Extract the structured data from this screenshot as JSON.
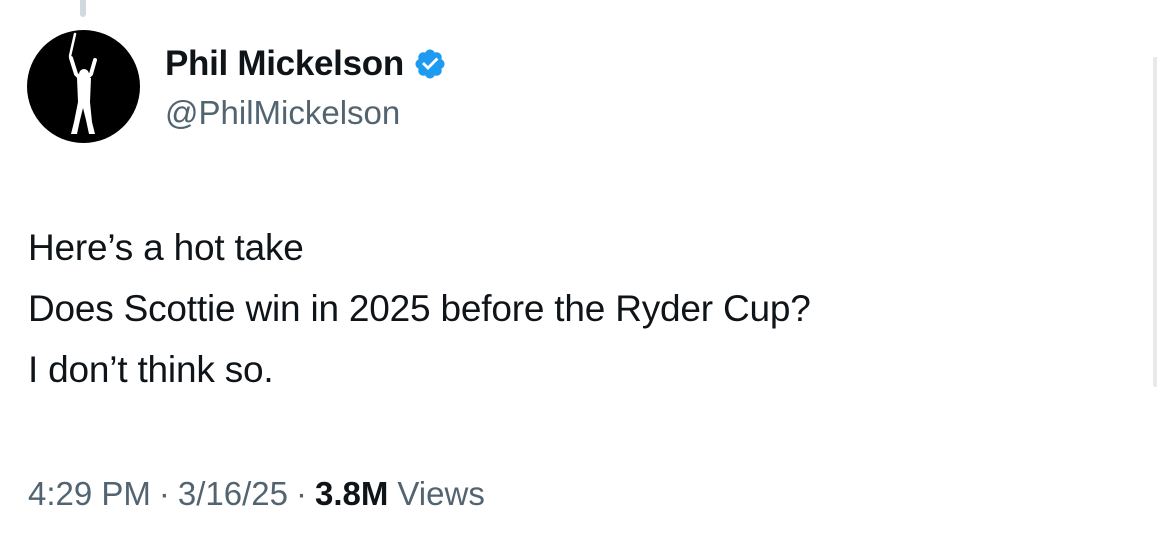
{
  "author": {
    "display_name": "Phil Mickelson",
    "handle": "@PhilMickelson",
    "verified": true,
    "verified_color": "#1d9bf0",
    "avatar_icon": "golfer-silhouette-icon"
  },
  "tweet": {
    "lines": [
      "Here’s a hot take",
      "Does Scottie win in 2025 before the Ryder Cup?",
      "I don’t think so."
    ]
  },
  "meta": {
    "time": "4:29 PM",
    "separator": "·",
    "date": "3/16/25",
    "views_count": "3.8M",
    "views_label": "Views"
  },
  "colors": {
    "text_primary": "#0f1419",
    "text_secondary": "#536471",
    "background": "#ffffff"
  }
}
